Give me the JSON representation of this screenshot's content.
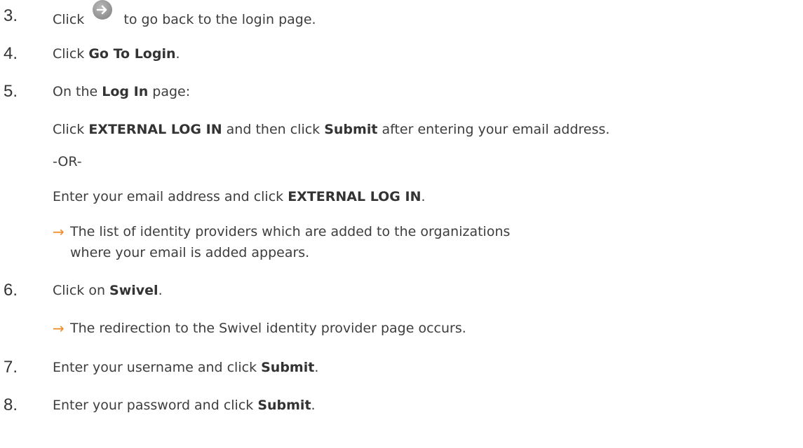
{
  "steps": [
    {
      "number": "3.",
      "before_icon": "Click",
      "icon": "arrow-right-circle-icon",
      "after_icon": "to go back to the login page."
    },
    {
      "number": "4.",
      "prefix": "Click ",
      "bold": "Go To Login",
      "suffix": "."
    },
    {
      "number": "5.",
      "line1_prefix": "On the ",
      "line1_bold": "Log In",
      "line1_suffix": " page:",
      "line2_prefix": "Click ",
      "line2_bold1": "EXTERNAL LOG IN",
      "line2_middle": " and then click ",
      "line2_bold2": "Submit",
      "line2_suffix": " after entering your email address.",
      "or_text": "-OR-",
      "line4_prefix": "Enter your email address and click ",
      "line4_bold": "EXTERNAL LOG IN",
      "line4_suffix": ".",
      "result_line1": "The list of identity providers which are added to the organizations",
      "result_line2": "where your email is added appears."
    },
    {
      "number": "6.",
      "prefix": "Click on ",
      "bold": "Swivel",
      "suffix": ".",
      "result": "The redirection to the Swivel identity provider page occurs."
    },
    {
      "number": "7.",
      "prefix": "Enter your username and click ",
      "bold": "Submit",
      "suffix": "."
    },
    {
      "number": "8.",
      "prefix": "Enter your password and click ",
      "bold": "Submit",
      "suffix": "."
    }
  ],
  "result_arrow": "→",
  "colors": {
    "arrow": "#f28c28",
    "icon_fill": "#9b9b9b",
    "text": "#3d3d3d"
  }
}
